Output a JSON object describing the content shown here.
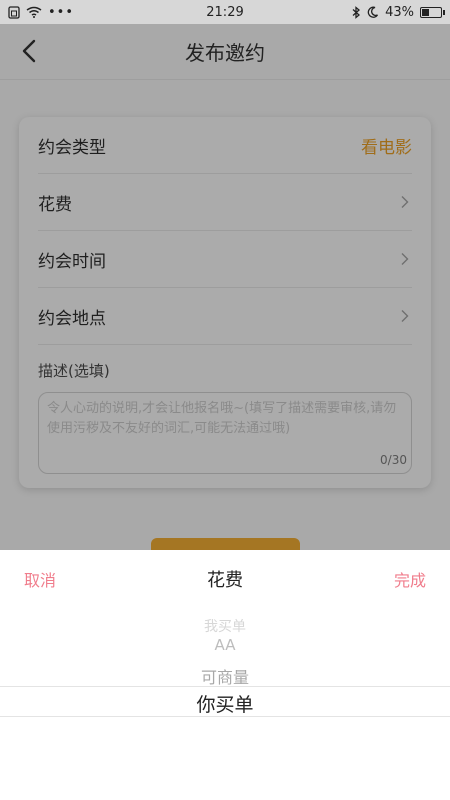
{
  "status_bar": {
    "time": "21:29",
    "battery": "43%",
    "battery_level": 0.43,
    "icons": [
      "sim-icon",
      "wifi-icon",
      "more-dots-icon",
      "bluetooth-icon",
      "moon-icon",
      "battery-icon"
    ]
  },
  "header": {
    "title": "发布邀约"
  },
  "form": {
    "date_type": {
      "label": "约会类型",
      "value": "看电影"
    },
    "cost": {
      "label": "花费"
    },
    "time": {
      "label": "约会时间"
    },
    "place": {
      "label": "约会地点"
    },
    "description": {
      "label": "描述(选填)",
      "placeholder": "令人心动的说明,才会让他报名哦~(填写了描述需要审核,请勿使用污秽及不友好的词汇,可能无法通过哦)",
      "counter": "0/30"
    }
  },
  "picker": {
    "cancel": "取消",
    "title": "花费",
    "confirm": "完成",
    "options": [
      "我买单",
      "AA",
      "可商量",
      "你买单"
    ],
    "selected": "你买单"
  },
  "colors": {
    "accent": "#a06d1a",
    "picker_button": "#f07d8c"
  }
}
